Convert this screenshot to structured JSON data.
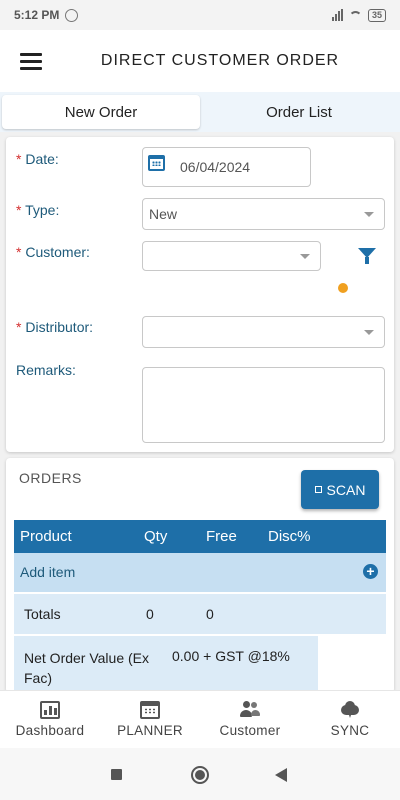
{
  "status": {
    "time": "5:12 PM",
    "battery": "35"
  },
  "app_bar": {
    "title": "DIRECT CUSTOMER ORDER"
  },
  "tabs": [
    {
      "label": "New Order",
      "active": true
    },
    {
      "label": "Order List",
      "active": false
    }
  ],
  "form": {
    "date_label": "Date:",
    "date_value": "06/04/2024",
    "type_label": "Type:",
    "type_value": "New",
    "customer_label": "Customer:",
    "customer_value": "",
    "distributor_label": "Distributor:",
    "distributor_value": "",
    "remarks_label": "Remarks:",
    "remarks_value": "",
    "required_mark": "*"
  },
  "orders": {
    "title": "ORDERS",
    "scan_label": "SCAN",
    "columns": [
      "Product",
      "Qty",
      "Free",
      "Disc%"
    ],
    "add_item_label": "Add item",
    "add_icon": "+",
    "totals": {
      "label": "Totals",
      "qty": "0",
      "free": "0"
    },
    "net_order": {
      "label": "Net Order Value (Ex Fac)",
      "value": "0.00 + GST @18%"
    }
  },
  "bottom_nav": [
    {
      "label": "Dashboard",
      "icon": "bar-chart-icon"
    },
    {
      "label": "PLANNER",
      "icon": "calendar-icon"
    },
    {
      "label": "Customer",
      "icon": "people-icon"
    },
    {
      "label": "SYNC",
      "icon": "cloud-sync-icon"
    }
  ],
  "colors": {
    "primary": "#1e6fa8",
    "required": "#d32f2f",
    "badge": "#f0a020"
  }
}
